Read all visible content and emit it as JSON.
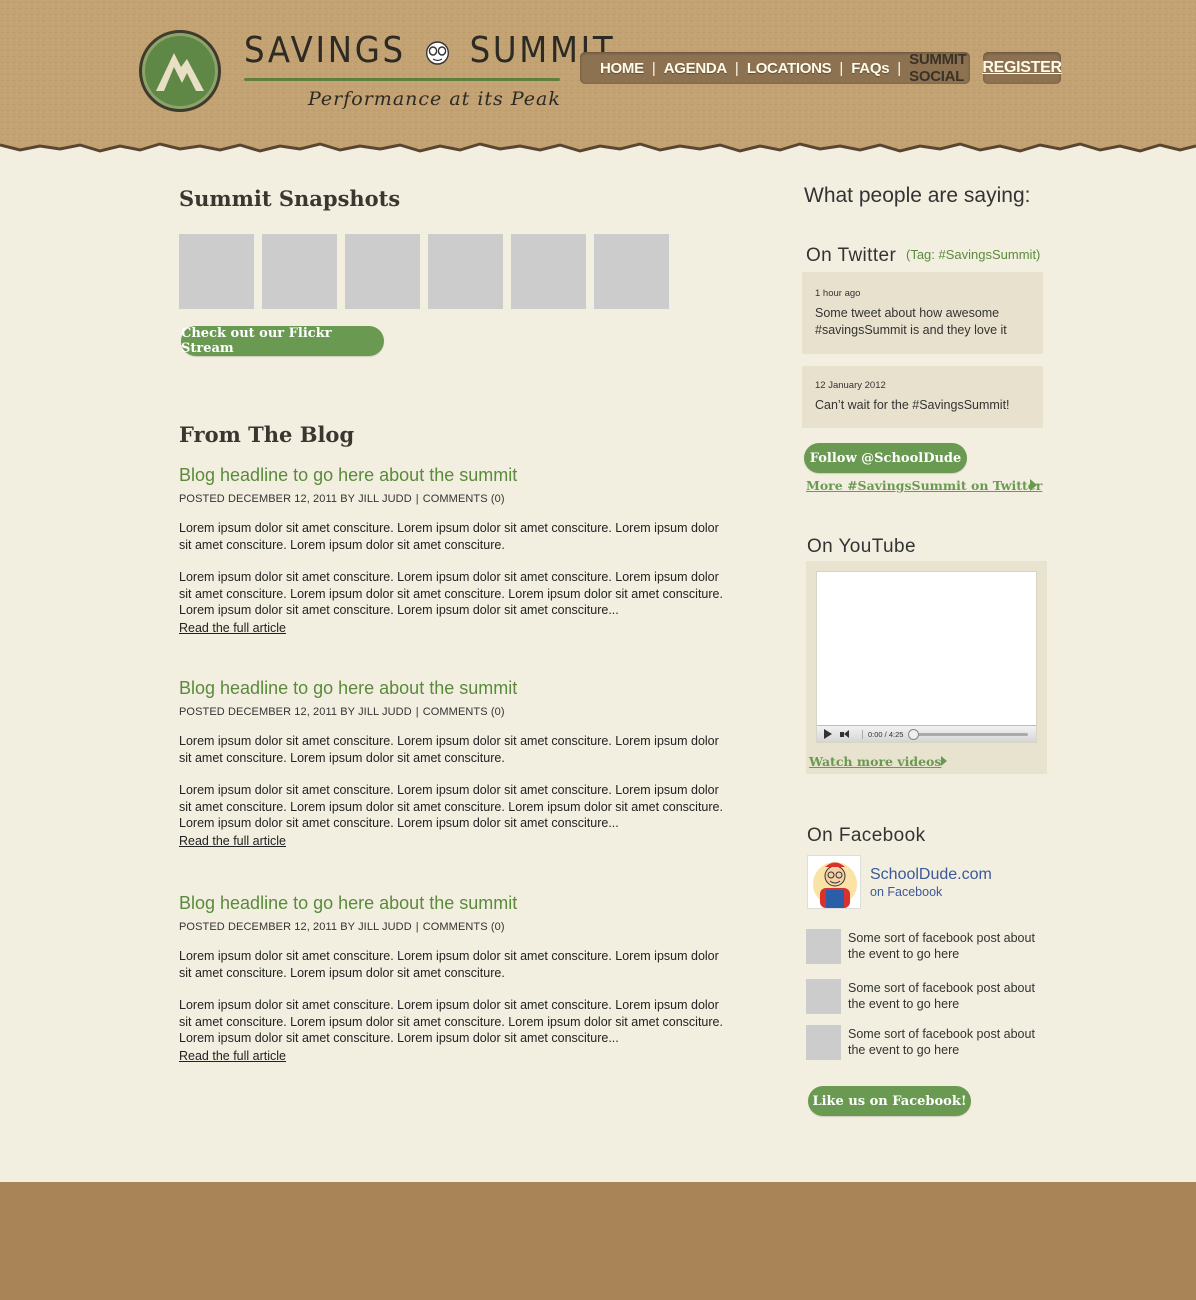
{
  "header": {
    "brand_title_left": "SAVINGS",
    "brand_title_right": "SUMMIT",
    "tagline": "Performance at its Peak",
    "nav": [
      "HOME",
      "AGENDA",
      "LOCATIONS",
      "FAQs",
      "SUMMIT SOCIAL"
    ],
    "register": "REGISTER"
  },
  "snapshots": {
    "title": "Summit Snapshots",
    "flickr_button": "Check out our Flickr Stream"
  },
  "blog": {
    "title": "From The Blog",
    "posts": [
      {
        "headline": "Blog headline to go here about the summit",
        "meta_posted": "POSTED DECEMBER 12, 2011 BY JILL JUDD",
        "meta_comments": "COMMENTS (0)",
        "p1": "Lorem ipsum dolor sit amet consciture. Lorem ipsum dolor sit amet consciture. Lorem ipsum dolor sit amet consciture. Lorem ipsum dolor sit amet consciture.",
        "p2": "Lorem ipsum dolor sit amet consciture. Lorem ipsum dolor sit amet consciture. Lorem ipsum dolor sit amet consciture. Lorem ipsum dolor sit amet consciture. Lorem ipsum dolor sit amet consciture. Lorem ipsum dolor sit amet consciture. Lorem ipsum dolor sit amet consciture...",
        "read_more": "Read the full article"
      },
      {
        "headline": "Blog headline to go here about the summit",
        "meta_posted": "POSTED DECEMBER 12, 2011 BY JILL JUDD",
        "meta_comments": "COMMENTS (0)",
        "p1": "Lorem ipsum dolor sit amet consciture. Lorem ipsum dolor sit amet consciture. Lorem ipsum dolor sit amet consciture. Lorem ipsum dolor sit amet consciture.",
        "p2": "Lorem ipsum dolor sit amet consciture. Lorem ipsum dolor sit amet consciture. Lorem ipsum dolor sit amet consciture. Lorem ipsum dolor sit amet consciture. Lorem ipsum dolor sit amet consciture. Lorem ipsum dolor sit amet consciture. Lorem ipsum dolor sit amet consciture...",
        "read_more": "Read the full article"
      },
      {
        "headline": "Blog headline to go here about the summit",
        "meta_posted": "POSTED DECEMBER 12, 2011 BY JILL JUDD",
        "meta_comments": "COMMENTS (0)",
        "p1": "Lorem ipsum dolor sit amet consciture. Lorem ipsum dolor sit amet consciture. Lorem ipsum dolor sit amet consciture. Lorem ipsum dolor sit amet consciture.",
        "p2": "Lorem ipsum dolor sit amet consciture. Lorem ipsum dolor sit amet consciture. Lorem ipsum dolor sit amet consciture. Lorem ipsum dolor sit amet consciture. Lorem ipsum dolor sit amet consciture. Lorem ipsum dolor sit amet consciture. Lorem ipsum dolor sit amet consciture...",
        "read_more": "Read the full article"
      }
    ]
  },
  "sidebar": {
    "title": "What people are saying:",
    "twitter": {
      "heading": "On Twitter",
      "tag": "(Tag: #SavingsSummit)",
      "tweets": [
        {
          "time": "1 hour ago",
          "text": "Some tweet about how awesome #savingsSummit is and they love it"
        },
        {
          "time": "12 January 2012",
          "text": "Can’t wait for the #SavingsSummit!"
        }
      ],
      "follow_button": "Follow @SchoolDude",
      "more_link": "More #SavingsSummit on Twitter"
    },
    "youtube": {
      "heading": "On YouTube",
      "time": "0:00 / 4:25",
      "progress": 0,
      "more_link": "Watch more videos"
    },
    "facebook": {
      "heading": "On Facebook",
      "page_name": "SchoolDude.com",
      "page_sub": "on Facebook",
      "posts": [
        "Some sort of facebook post about the event to go here",
        "Some sort of facebook post about the event to go here",
        "Some sort of facebook post about the event to go here"
      ],
      "like_button": "Like us on Facebook!"
    }
  },
  "colors": {
    "accent_green": "#6a9a52",
    "header_brown": "#c0a070",
    "footer_brown": "#a88457",
    "paper": "#f3efe0"
  }
}
